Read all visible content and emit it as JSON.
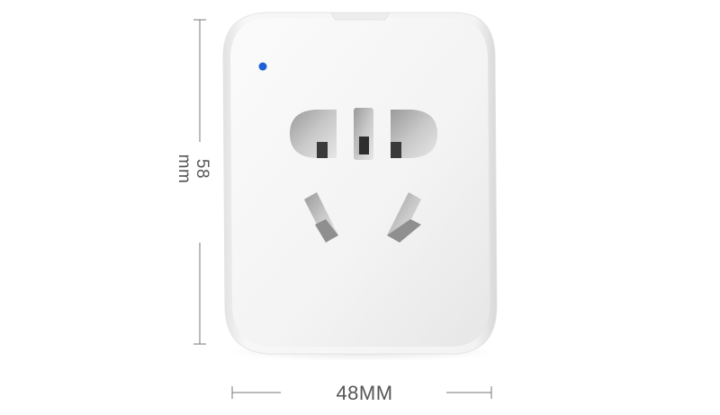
{
  "dimensions": {
    "height_label": "58 mm",
    "width_label": "48MM"
  },
  "device": {
    "indicator_color": "#1e5fd6",
    "body_color": "#f4f4f4"
  }
}
